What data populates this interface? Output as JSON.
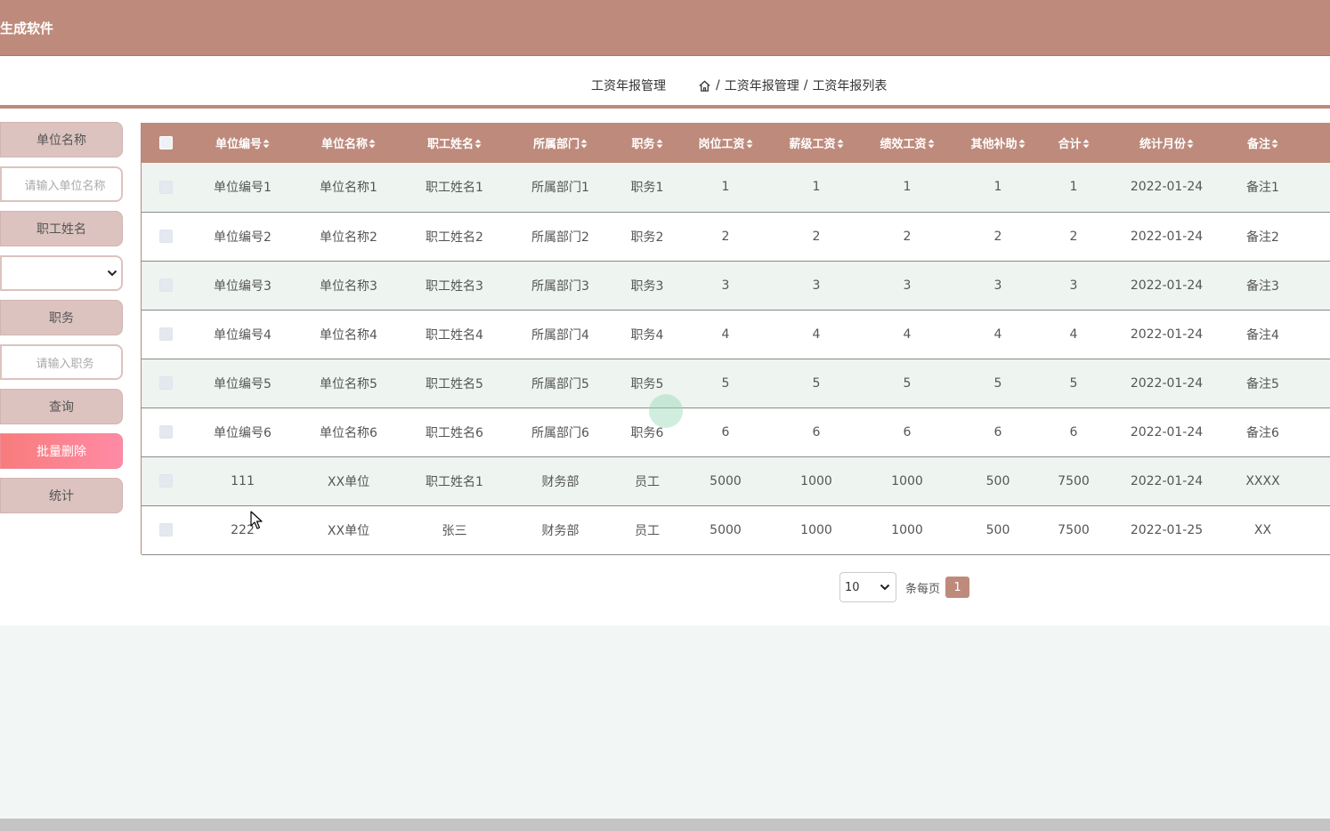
{
  "header": {
    "app_title": "生成软件"
  },
  "breadcrumb": {
    "title": "工资年报管理",
    "items": [
      "工资年报管理",
      "工资年报列表"
    ],
    "separator": "/"
  },
  "sidebar": {
    "unit_name_label": "单位名称",
    "unit_name_placeholder": "请输入单位名称",
    "employee_name_label": "职工姓名",
    "employee_name_value": "",
    "position_label": "职务",
    "position_placeholder": "请输入职务",
    "query_button": "查询",
    "batch_delete_button": "批量删除",
    "stats_button": "统计"
  },
  "table": {
    "columns": [
      "单位编号",
      "单位名称",
      "职工姓名",
      "所属部门",
      "职务",
      "岗位工资",
      "薪级工资",
      "绩效工资",
      "其他补助",
      "合计",
      "统计月份",
      "备注"
    ],
    "rows": [
      [
        "单位编号1",
        "单位名称1",
        "职工姓名1",
        "所属部门1",
        "职务1",
        "1",
        "1",
        "1",
        "1",
        "1",
        "2022-01-24",
        "备注1"
      ],
      [
        "单位编号2",
        "单位名称2",
        "职工姓名2",
        "所属部门2",
        "职务2",
        "2",
        "2",
        "2",
        "2",
        "2",
        "2022-01-24",
        "备注2"
      ],
      [
        "单位编号3",
        "单位名称3",
        "职工姓名3",
        "所属部门3",
        "职务3",
        "3",
        "3",
        "3",
        "3",
        "3",
        "2022-01-24",
        "备注3"
      ],
      [
        "单位编号4",
        "单位名称4",
        "职工姓名4",
        "所属部门4",
        "职务4",
        "4",
        "4",
        "4",
        "4",
        "4",
        "2022-01-24",
        "备注4"
      ],
      [
        "单位编号5",
        "单位名称5",
        "职工姓名5",
        "所属部门5",
        "职务5",
        "5",
        "5",
        "5",
        "5",
        "5",
        "2022-01-24",
        "备注5"
      ],
      [
        "单位编号6",
        "单位名称6",
        "职工姓名6",
        "所属部门6",
        "职务6",
        "6",
        "6",
        "6",
        "6",
        "6",
        "2022-01-24",
        "备注6"
      ],
      [
        "111",
        "XX单位",
        "职工姓名1",
        "财务部",
        "员工",
        "5000",
        "1000",
        "1000",
        "500",
        "7500",
        "2022-01-24",
        "XXXX"
      ],
      [
        "222",
        "XX单位",
        "张三",
        "财务部",
        "员工",
        "5000",
        "1000",
        "1000",
        "500",
        "7500",
        "2022-01-25",
        "XX"
      ]
    ]
  },
  "pagination": {
    "page_size": "10",
    "per_page_label": "条每页",
    "current_page": "1"
  },
  "colors": {
    "primary": "#be8a7b",
    "sidebar_label": "#dcc3bf",
    "danger_gradient_start": "#f87c7c",
    "danger_gradient_end": "#ff8aa5",
    "row_alt": "#eef5f1"
  },
  "icons": {
    "breadcrumb_home": "home-icon",
    "sort": "sort-icon",
    "select_arrow": "chevron-down-icon"
  }
}
